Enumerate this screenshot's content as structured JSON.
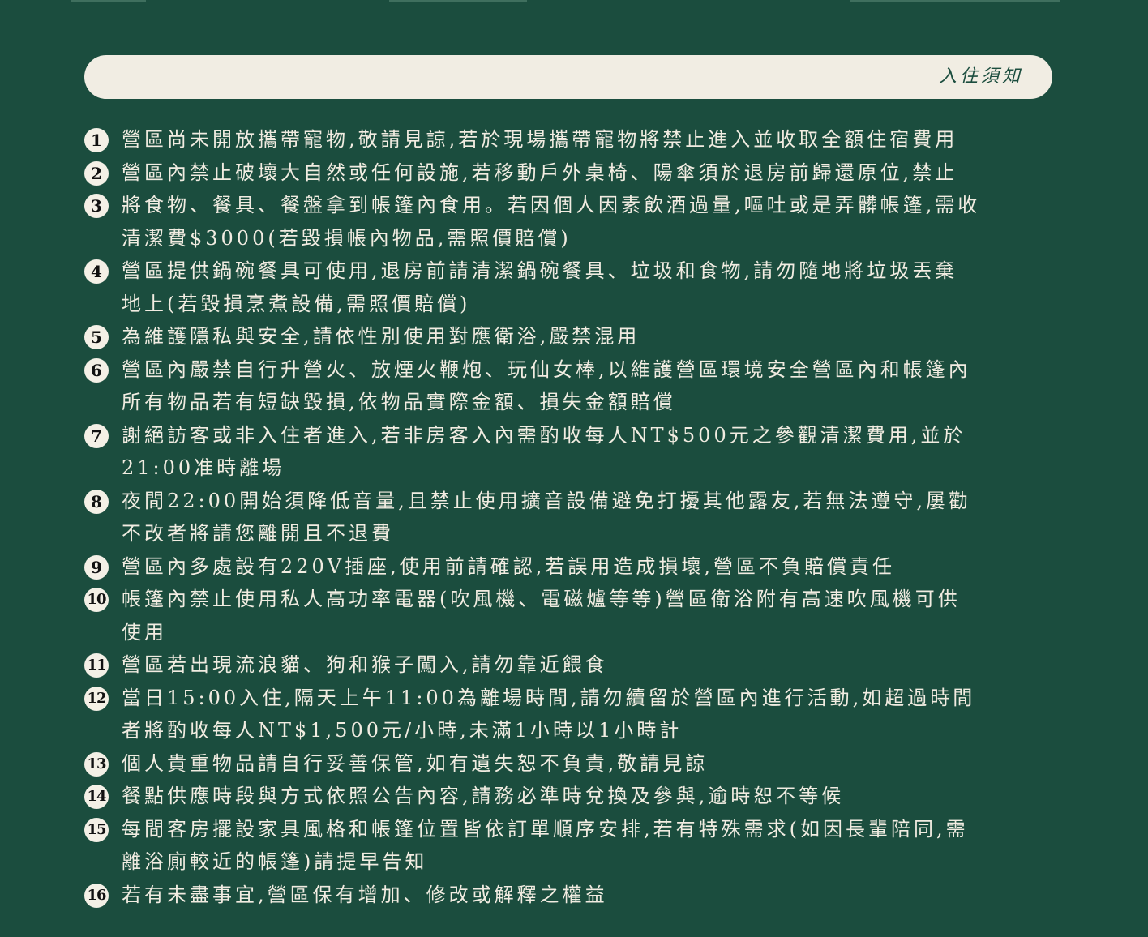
{
  "header": {
    "title": "入住須知"
  },
  "colors": {
    "background": "#1b4d3e",
    "header_bar": "#f1ede3",
    "text": "#f1ece1",
    "badge": "#f4f0e6"
  },
  "rules": [
    {
      "num": "1",
      "lines": [
        "營區尚未開放攜帶寵物,敬請見諒,若於現場攜帶寵物將禁止進入並收取全額住宿費用"
      ]
    },
    {
      "num": "2",
      "lines": [
        "營區內禁止破壞大自然或任何設施,若移動戶外桌椅、陽傘須於退房前歸還原位,禁止"
      ]
    },
    {
      "num": "3",
      "lines": [
        "將食物、餐具、餐盤拿到帳篷內食用。若因個人因素飲酒過量,嘔吐或是弄髒帳篷,需收",
        "清潔費$3000(若毀損帳內物品,需照價賠償)"
      ]
    },
    {
      "num": "4",
      "lines": [
        "營區提供鍋碗餐具可使用,退房前請清潔鍋碗餐具、垃圾和食物,請勿隨地將垃圾丟棄",
        "地上(若毀損烹煮設備,需照價賠償)"
      ]
    },
    {
      "num": "5",
      "lines": [
        "為維護隱私與安全,請依性別使用對應衛浴,嚴禁混用"
      ]
    },
    {
      "num": "6",
      "lines": [
        "營區內嚴禁自行升營火、放煙火鞭炮、玩仙女棒,以維護營區環境安全營區內和帳篷內",
        "所有物品若有短缺毀損,依物品實際金額、損失金額賠償"
      ]
    },
    {
      "num": "7",
      "lines": [
        "謝絕訪客或非入住者進入,若非房客入內需酌收每人NT$500元之參觀清潔費用,並於",
        "21:00准時離場"
      ]
    },
    {
      "num": "8",
      "lines": [
        "夜間22:00開始須降低音量,且禁止使用擴音設備避免打擾其他露友,若無法遵守,屢勸",
        "不改者將請您離開且不退費"
      ]
    },
    {
      "num": "9",
      "lines": [
        "營區內多處設有220V插座,使用前請確認,若誤用造成損壞,營區不負賠償責任"
      ]
    },
    {
      "num": "10",
      "lines": [
        "帳篷內禁止使用私人高功率電器(吹風機、電磁爐等等)營區衛浴附有高速吹風機可供",
        "使用"
      ]
    },
    {
      "num": "11",
      "lines": [
        "營區若出現流浪貓、狗和猴子闖入,請勿靠近餵食"
      ]
    },
    {
      "num": "12",
      "lines": [
        "當日15:00入住,隔天上午11:00為離場時間,請勿續留於營區內進行活動,如超過時間",
        "者將酌收每人NT$1,500元/小時,未滿1小時以1小時計"
      ]
    },
    {
      "num": "13",
      "lines": [
        "個人貴重物品請自行妥善保管,如有遺失恕不負責,敬請見諒"
      ]
    },
    {
      "num": "14",
      "lines": [
        "餐點供應時段與方式依照公告內容,請務必準時兌換及參與,逾時恕不等候"
      ]
    },
    {
      "num": "15",
      "lines": [
        "每間客房擺設家具風格和帳篷位置皆依訂單順序安排,若有特殊需求(如因長輩陪同,需",
        "離浴廁較近的帳篷)請提早告知"
      ]
    },
    {
      "num": "16",
      "lines": [
        "若有未盡事宜,營區保有增加、修改或解釋之權益"
      ]
    }
  ]
}
